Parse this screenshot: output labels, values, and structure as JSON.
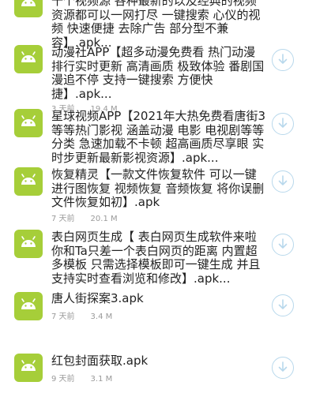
{
  "colors": {
    "icon_bg": "#a6ce39",
    "title": "#222222",
    "meta": "#9a9a9a",
    "download_ring": "#b8d8ec"
  },
  "items": [
    {
      "title": "十个视频源 各种最新的以及经典的视频资源都可以一网打尽 一键搜索 心仪的视频 快速便捷 去除广告 部分型不兼容】.apk...",
      "icon": "android-icon"
    },
    {
      "title": "动漫社APP【超多动漫免费看 热门动漫排行实时更新 高清画质 极致体验 番剧国漫追不停 支持一键搜索 方便快捷】.apk...",
      "age": "3 天前",
      "size": "19.4 M",
      "icon": "android-icon",
      "action": "download-icon"
    },
    {
      "title": "星球视频APP【2021年大热免费看唐街3等等热门影视 涵盖动漫 电影 电视剧等等分类 急速加载不卡顿 超高画质尽享眼 实时步更新最新影视资源】.apk...",
      "icon": "android-icon",
      "action": "download-icon"
    },
    {
      "title": "恢复精灵【一款文件恢复软件 可以一键进行图恢复 视频恢复 音频恢复 将你误删文件恢复如初】.apk",
      "age": "7 天前",
      "size": "20.1 M",
      "icon": "android-icon",
      "action": "download-icon"
    },
    {
      "title": "表白网页生成【 表白网页生成软件来啦 你和Ta只差一个表白网页的距离 内置超多模板 只需选择模板即可一键生成 并且支持实时查看浏览和修改】.apk...",
      "icon": "android-icon",
      "action": "download-icon"
    },
    {
      "title": "唐人街探案3.apk",
      "age": "7 天前",
      "size": "3.4 M",
      "icon": "android-icon",
      "action": "download-icon"
    },
    {
      "title": "红包封面获取.apk",
      "age": "9 天前",
      "size": "3.1 M",
      "icon": "android-icon",
      "action": "download-icon"
    }
  ]
}
